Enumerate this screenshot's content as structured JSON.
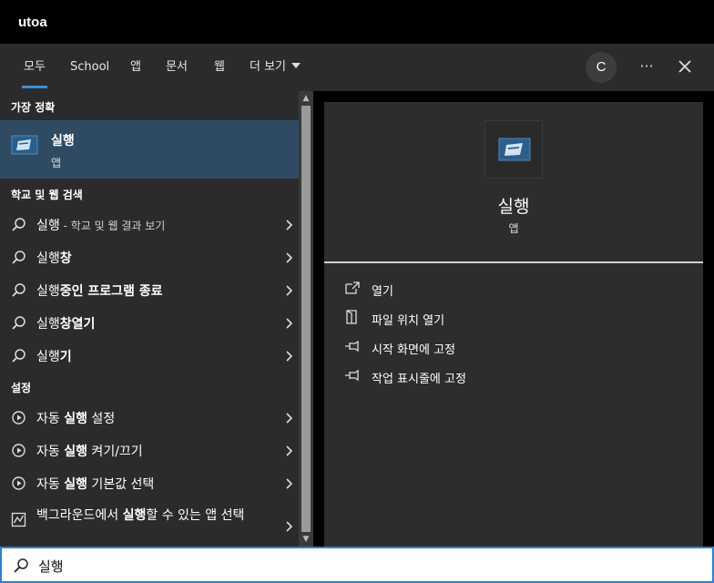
{
  "window": {
    "title": "utoa"
  },
  "tabs": [
    {
      "label": "모두"
    },
    {
      "label": "School"
    },
    {
      "label": "앱"
    },
    {
      "label": "문서"
    },
    {
      "label": "웹"
    },
    {
      "label": "더 보기"
    }
  ],
  "account": {
    "initial": "C"
  },
  "menu": {
    "more_label": "···"
  },
  "left": {
    "best_match": {
      "heading": "가장 정확",
      "name": "실행",
      "type": "앱"
    },
    "web_search": {
      "heading": "학교 및 웹 검색",
      "items": [
        {
          "prefix": "실행",
          "bold": "",
          "suffix": " - 학교 및 웹 결과 보기"
        },
        {
          "prefix": "실행",
          "bold": "창",
          "suffix": ""
        },
        {
          "prefix": "실행",
          "bold": "중인 프로그램 종료",
          "suffix": ""
        },
        {
          "prefix": "실행",
          "bold": "창열기",
          "suffix": ""
        },
        {
          "prefix": "실행",
          "bold": "기",
          "suffix": ""
        }
      ]
    },
    "settings": {
      "heading": "설정",
      "items": [
        {
          "prefix": "자동 ",
          "bold": "실행",
          "suffix": " 설정"
        },
        {
          "prefix": "자동 ",
          "bold": "실행",
          "suffix": " 켜기/끄기"
        },
        {
          "prefix": "자동 ",
          "bold": "실행",
          "suffix": " 기본값 선택"
        },
        {
          "prefix": "백그라운드에서 ",
          "bold": "실행",
          "suffix": "할 수 있는 앱 선택"
        }
      ]
    }
  },
  "right": {
    "app_name": "실행",
    "app_type": "앱",
    "actions": [
      {
        "label": "열기",
        "icon": "open-icon"
      },
      {
        "label": "파일 위치 열기",
        "icon": "file-location-icon"
      },
      {
        "label": "시작 화면에 고정",
        "icon": "pin-icon"
      },
      {
        "label": "작업 표시줄에 고정",
        "icon": "pin-icon"
      }
    ]
  },
  "search": {
    "value": "실행"
  },
  "colors": {
    "accent": "#3c8fd8",
    "selected": "#2f4a63",
    "panel": "#2b2b2b"
  }
}
